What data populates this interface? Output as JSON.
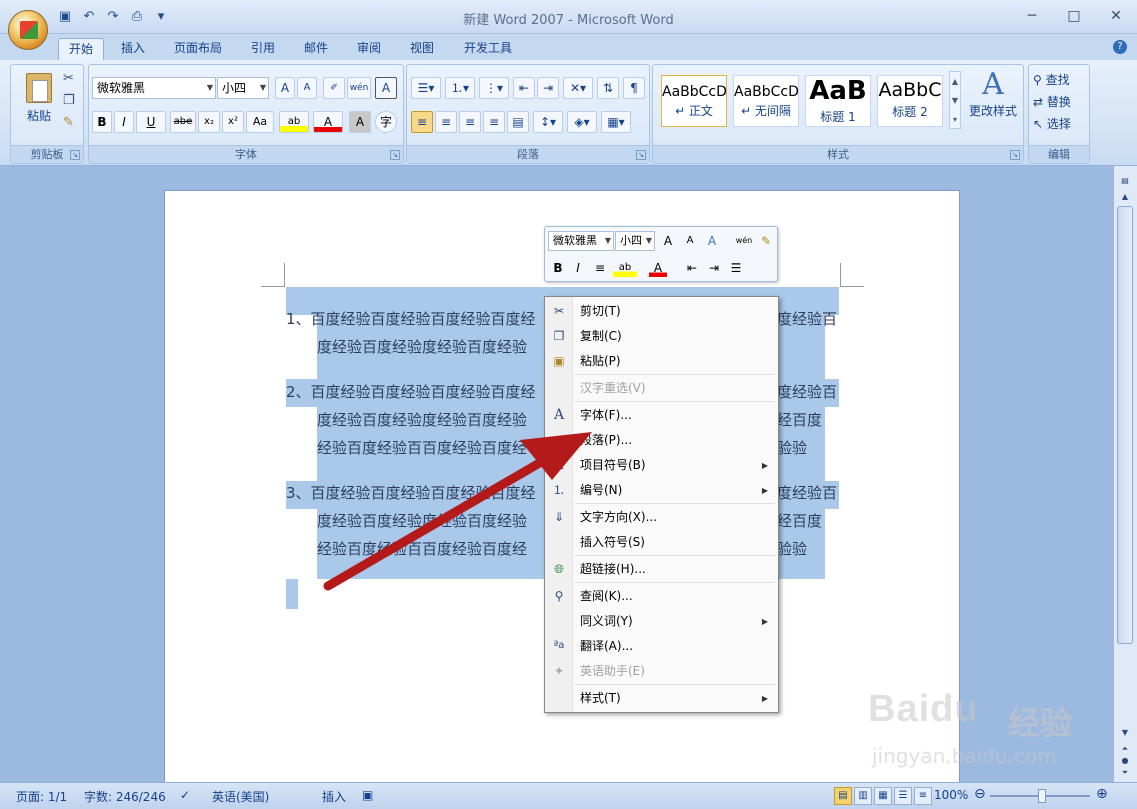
{
  "window": {
    "title": "新建 Word 2007 - Microsoft Word",
    "minimize": "─",
    "maximize": "□",
    "close": "✕"
  },
  "qat": [
    "save-icon",
    "undo-icon",
    "redo-icon",
    "print-preview-icon",
    "customize-icon"
  ],
  "tabs": [
    "开始",
    "插入",
    "页面布局",
    "引用",
    "邮件",
    "审阅",
    "视图",
    "开发工具"
  ],
  "ribbon": {
    "clipboard": {
      "label": "剪贴板",
      "paste": "粘贴"
    },
    "font": {
      "label": "字体",
      "font_name": "微软雅黑",
      "font_size": "小四",
      "bold": "B",
      "italic": "I",
      "underline": "U",
      "strike": "abe",
      "subscript": "x₂",
      "superscript": "x²",
      "change_case": "Aa",
      "grow": "A",
      "shrink": "A",
      "phonetic": "wén",
      "border": "A",
      "shade": "A",
      "enclose": "字"
    },
    "paragraph": {
      "label": "段落"
    },
    "styles": {
      "label": "样式",
      "items": [
        {
          "sample": "AaBbCcD",
          "name": "↵ 正文"
        },
        {
          "sample": "AaBbCcD",
          "name": "↵ 无间隔"
        },
        {
          "sample": "AaB",
          "name": "标题 1"
        },
        {
          "sample": "AaBbC",
          "name": "标题 2"
        }
      ],
      "change": "更改样式"
    },
    "editing": {
      "label": "编辑",
      "find": "查找",
      "replace": "替换",
      "select": "选择"
    }
  },
  "document": {
    "para1_line1": "1、百度经验百度经验百度经验百度经",
    "para1_line1_right": "度经验百",
    "para1_line2": "度经验百度经验度经验百度经验",
    "para2_line1": "2、百度经验百度经验百度经验百度经",
    "para2_line1_right": "度经验百",
    "para2_line2": "度经验百度经验度经验百度经验",
    "para2_line2_right": "经百度",
    "para2_line3": "经验百度经验百百度经验百度经",
    "para2_line3_right": "验验",
    "para3_line1": "3、百度经验百度经验百度经验百度经",
    "para3_line1_right": "度经验百",
    "para3_line2": "度经验百度经验度经验百度经验",
    "para3_line2_right": "经百度",
    "para3_line3": "经验百度经验百百度经验百度经",
    "para3_line3_right": "验验"
  },
  "mini_toolbar": {
    "font": "微软雅黑",
    "size": "小四",
    "grow": "A",
    "shrink": "A",
    "styles": "A",
    "phonetic": "wén",
    "bold": "B",
    "italic": "I",
    "center": "≡",
    "highlight": "ab",
    "font_color": "A",
    "outdent": "⇤",
    "indent": "⇥",
    "bullets": "☰"
  },
  "context_menu": {
    "items": [
      {
        "label": "剪切(T)",
        "icon": "scissors-icon",
        "disabled": false
      },
      {
        "label": "复制(C)",
        "icon": "copy-icon",
        "disabled": false
      },
      {
        "label": "粘贴(P)",
        "icon": "paste-icon",
        "disabled": false
      },
      {
        "label": "汉字重选(V)",
        "icon": "",
        "disabled": true
      },
      {
        "label": "字体(F)...",
        "icon": "font-icon",
        "disabled": false
      },
      {
        "label": "段落(P)...",
        "icon": "paragraph-icon",
        "disabled": false
      },
      {
        "label": "项目符号(B)",
        "icon": "bullets-icon",
        "disabled": false
      },
      {
        "label": "编号(N)",
        "icon": "numbering-icon",
        "disabled": false
      },
      {
        "label": "文字方向(X)...",
        "icon": "text-direction-icon",
        "disabled": false
      },
      {
        "label": "插入符号(S)",
        "icon": "",
        "disabled": false
      },
      {
        "label": "超链接(H)...",
        "icon": "hyperlink-icon",
        "disabled": false
      },
      {
        "label": "查阅(K)...",
        "icon": "research-icon",
        "disabled": false
      },
      {
        "label": "同义词(Y)",
        "icon": "",
        "disabled": false
      },
      {
        "label": "翻译(A)...",
        "icon": "translate-icon",
        "disabled": false
      },
      {
        "label": "英语助手(E)",
        "icon": "english-assistant-icon",
        "disabled": true
      },
      {
        "label": "样式(T)",
        "icon": "",
        "disabled": false
      }
    ]
  },
  "status": {
    "page": "页面: 1/1",
    "words": "字数: 246/246",
    "language": "英语(美国)",
    "mode": "插入",
    "zoom": "100%",
    "zoom_minus": "⊖",
    "zoom_plus": "⊕"
  },
  "watermark": {
    "brand": "Baidu",
    "cn": "经验",
    "url": "jingyan.baidu.com"
  },
  "colors": {
    "selection": "#a9c8ea",
    "arrow": "#b51a1a",
    "ribbon": "#d3e2f5"
  }
}
